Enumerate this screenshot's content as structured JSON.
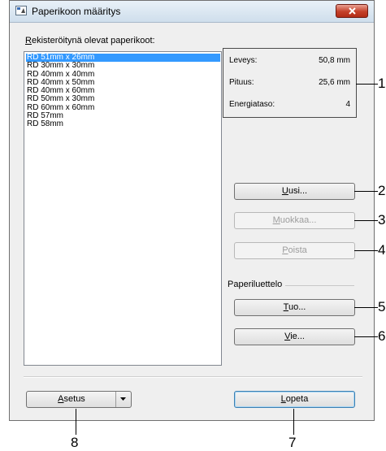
{
  "window": {
    "title": "Paperikoon määritys"
  },
  "list": {
    "label_accel": "R",
    "label_rest": "ekisteröitynä olevat paperikoot:",
    "items": [
      "RD 51mm x 26mm",
      "RD 30mm x 30mm",
      "RD 40mm x 40mm",
      "RD 40mm x 50mm",
      "RD 40mm x 60mm",
      "RD 50mm x 30mm",
      "RD 60mm x 60mm",
      "RD 57mm",
      "RD 58mm"
    ],
    "selected_index": 0
  },
  "info": {
    "width_label": "Leveys:",
    "width_value": "50,8 mm",
    "length_label": "Pituus:",
    "length_value": "25,6 mm",
    "energy_label": "Energiataso:",
    "energy_value": "4"
  },
  "buttons": {
    "new": {
      "accel": "U",
      "rest": "usi..."
    },
    "edit": {
      "accel": "M",
      "rest": "uokkaa..."
    },
    "delete": {
      "accel": "P",
      "rest": "oista"
    },
    "import": {
      "accel": "T",
      "rest": "uo..."
    },
    "export": {
      "accel": "V",
      "rest": "ie..."
    },
    "settings": {
      "accel": "A",
      "rest": "setus"
    },
    "close": {
      "accel": "L",
      "rest": "opeta"
    }
  },
  "paper_list_group": "Paperiluettelo",
  "callouts": [
    "1",
    "2",
    "3",
    "4",
    "5",
    "6",
    "7",
    "8"
  ]
}
